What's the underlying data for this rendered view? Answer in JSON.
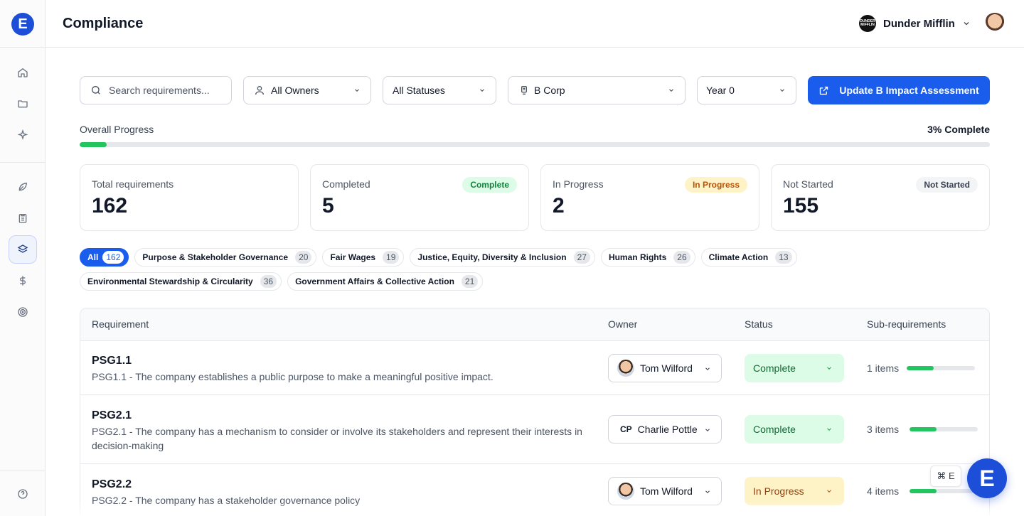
{
  "app": {
    "logo_letter": "E"
  },
  "sidebar": {
    "items": [
      {
        "icon": "home-icon"
      },
      {
        "icon": "folder-icon"
      },
      {
        "icon": "sparkles-icon"
      },
      {
        "icon": "leaf-icon"
      },
      {
        "icon": "clipboard-icon"
      },
      {
        "icon": "layers-icon",
        "active": true
      },
      {
        "icon": "dollar-icon"
      },
      {
        "icon": "target-icon"
      },
      {
        "icon": "help-icon"
      }
    ]
  },
  "header": {
    "title": "Compliance",
    "org_name": "Dunder Mifflin",
    "org_logo_text": "DUNDER MIFFLIN"
  },
  "filters": {
    "search_placeholder": "Search requirements...",
    "owners": "All Owners",
    "statuses": "All Statuses",
    "framework": "B Corp",
    "year": "Year 0",
    "action_button": "Update B Impact Assessment"
  },
  "progress": {
    "label": "Overall Progress",
    "value_text": "3% Complete",
    "percent": 3
  },
  "stats": [
    {
      "label": "Total requirements",
      "value": "162",
      "badge": ""
    },
    {
      "label": "Completed",
      "value": "5",
      "badge": "Complete"
    },
    {
      "label": "In Progress",
      "value": "2",
      "badge": "In Progress"
    },
    {
      "label": "Not Started",
      "value": "155",
      "badge": "Not Started"
    }
  ],
  "categories": [
    {
      "label": "All",
      "count": "162"
    },
    {
      "label": "Purpose & Stakeholder Governance",
      "count": "20"
    },
    {
      "label": "Fair Wages",
      "count": "19"
    },
    {
      "label": "Justice, Equity, Diversity & Inclusion",
      "count": "27"
    },
    {
      "label": "Human Rights",
      "count": "26"
    },
    {
      "label": "Climate Action",
      "count": "13"
    },
    {
      "label": "Environmental Stewardship & Circularity",
      "count": "36"
    },
    {
      "label": "Government Affairs & Collective Action",
      "count": "21"
    }
  ],
  "table": {
    "headers": [
      "Requirement",
      "Owner",
      "Status",
      "Sub-requirements"
    ],
    "rows": [
      {
        "id": "PSG1.1",
        "desc": "PSG1.1 - The company establishes a public purpose to make a meaningful positive impact.",
        "owner": "Tom Wilford",
        "owner_initials": "",
        "status": "Complete",
        "sub": "1 items",
        "sub_fraction": 0.4
      },
      {
        "id": "PSG2.1",
        "desc": "PSG2.1 - The company has a mechanism to consider or involve its stakeholders and represent their interests in decision-making",
        "owner": "Charlie Pottle",
        "owner_initials": "CP",
        "status": "Complete",
        "sub": "3 items",
        "sub_fraction": 0.4
      },
      {
        "id": "PSG2.2",
        "desc": "PSG2.2 - The company has a stakeholder governance policy",
        "owner": "Tom Wilford",
        "owner_initials": "",
        "status": "In Progress",
        "sub": "4 items",
        "sub_fraction": 0.4
      }
    ]
  },
  "shortcut": "⌘ E",
  "fab_letter": "E"
}
